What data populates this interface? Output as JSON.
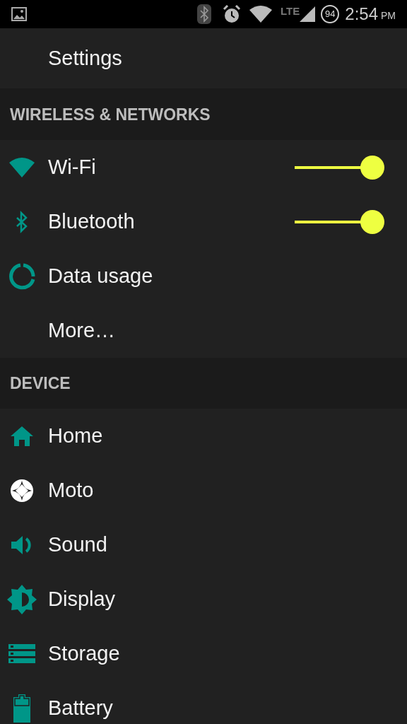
{
  "status_bar": {
    "network": "LTE",
    "battery": "94",
    "time": "2:54",
    "meridiem": "PM"
  },
  "title": "Settings",
  "sections": [
    {
      "header": "WIRELESS & NETWORKS",
      "items": [
        {
          "label": "Wi-Fi",
          "kind": "switch",
          "on": true
        },
        {
          "label": "Bluetooth",
          "kind": "switch",
          "on": true
        },
        {
          "label": "Data usage",
          "kind": "plain"
        },
        {
          "label": "More…",
          "kind": "plain"
        }
      ]
    },
    {
      "header": "DEVICE",
      "items": [
        {
          "label": "Home",
          "kind": "plain"
        },
        {
          "label": "Moto",
          "kind": "plain"
        },
        {
          "label": "Sound",
          "kind": "plain"
        },
        {
          "label": "Display",
          "kind": "plain"
        },
        {
          "label": "Storage",
          "kind": "plain"
        },
        {
          "label": "Battery",
          "kind": "plain"
        }
      ]
    }
  ]
}
